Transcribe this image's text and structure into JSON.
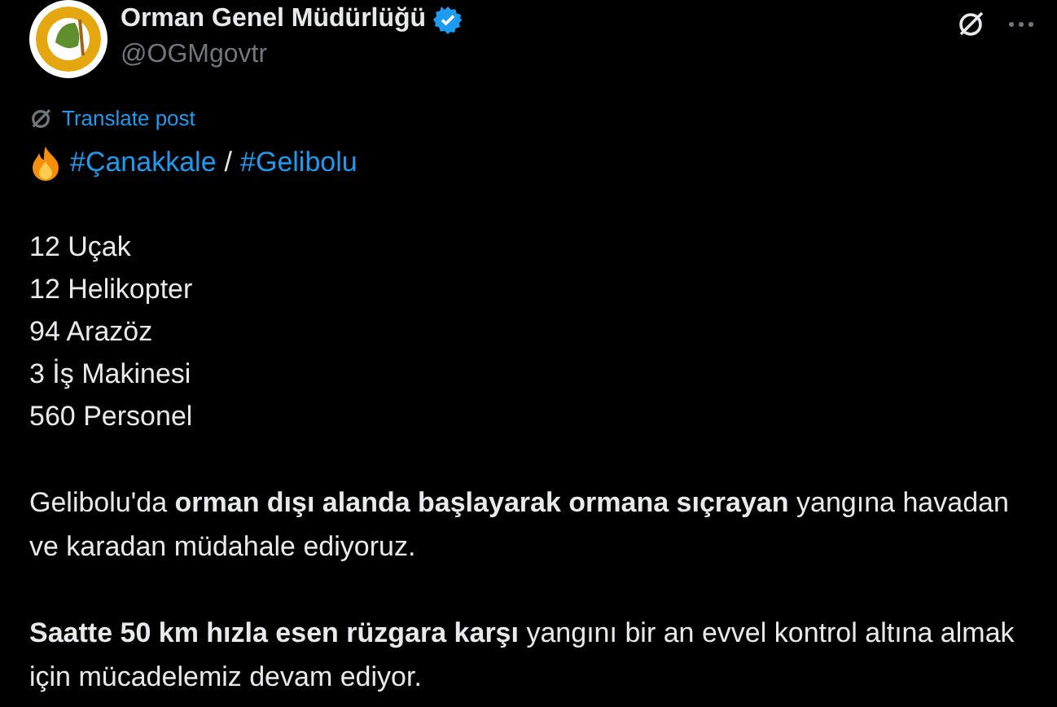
{
  "author": {
    "name": "Orman Genel Müdürlüğü",
    "verified": true,
    "handle": "@OGMgovtr"
  },
  "translate_link": "Translate post",
  "hashtag_line": {
    "tags": [
      "#Çanakkale",
      "#Gelibolu"
    ],
    "separator": "/"
  },
  "stats": [
    "12 Uçak",
    "12 Helikopter",
    "94 Arazöz",
    "3 İş Makinesi",
    "560 Personel"
  ],
  "paragraphs": [
    "Gelibolu'da **orman dışı alanda başlayarak ormana sıçrayan** yangına havadan ve karadan müdahale ediyoruz.",
    "**Saatte 50 km hızla esen rüzgara karşı** yangını bir an evvel kontrol altına almak için mücadelemiz devam ediyor."
  ]
}
